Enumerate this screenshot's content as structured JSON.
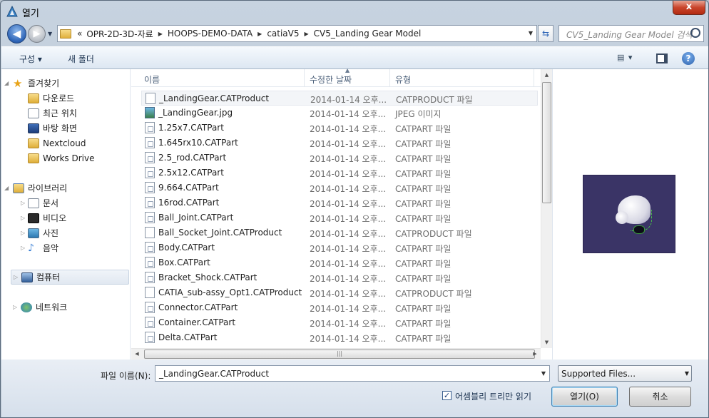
{
  "window": {
    "title": "열기",
    "close_label": "x"
  },
  "nav": {
    "back_label": "◀",
    "forward_label": "▶",
    "address_prefix": "«",
    "breadcrumbs": [
      "OPR-2D-3D-자료",
      "HOOPS-DEMO-DATA",
      "catiaV5",
      "CV5_Landing Gear Model"
    ],
    "search_placeholder": "CV5_Landing Gear Model 검색"
  },
  "toolbar": {
    "organize_label": "구성 ▾",
    "new_folder_label": "새 폴더",
    "view_label": "▤ ▾",
    "help_label": "?"
  },
  "sidebar": {
    "favorites": {
      "label": "즐겨찾기",
      "items": [
        "다운로드",
        "최근 위치",
        "바탕 화면",
        "Nextcloud",
        "Works Drive"
      ]
    },
    "libraries": {
      "label": "라이브러리",
      "items": [
        "문서",
        "비디오",
        "사진",
        "음악"
      ]
    },
    "computer_label": "컴퓨터",
    "network_label": "네트워크"
  },
  "filelist": {
    "columns": {
      "name": "이름",
      "date": "수정한 날짜",
      "type": "유형"
    },
    "rows": [
      {
        "name": "_LandingGear.CATProduct",
        "date": "2014-01-14 오후...",
        "type": "CATPRODUCT 파일",
        "icon": "blank"
      },
      {
        "name": "_LandingGear.jpg",
        "date": "2014-01-14 오후...",
        "type": "JPEG 이미지",
        "icon": "image"
      },
      {
        "name": "1.25x7.CATPart",
        "date": "2014-01-14 오후...",
        "type": "CATPART 파일",
        "icon": "part"
      },
      {
        "name": "1.645rx10.CATPart",
        "date": "2014-01-14 오후...",
        "type": "CATPART 파일",
        "icon": "part"
      },
      {
        "name": "2.5_rod.CATPart",
        "date": "2014-01-14 오후...",
        "type": "CATPART 파일",
        "icon": "part"
      },
      {
        "name": "2.5x12.CATPart",
        "date": "2014-01-14 오후...",
        "type": "CATPART 파일",
        "icon": "part"
      },
      {
        "name": "9.664.CATPart",
        "date": "2014-01-14 오후...",
        "type": "CATPART 파일",
        "icon": "part"
      },
      {
        "name": "16rod.CATPart",
        "date": "2014-01-14 오후...",
        "type": "CATPART 파일",
        "icon": "part"
      },
      {
        "name": "Ball_Joint.CATPart",
        "date": "2014-01-14 오후...",
        "type": "CATPART 파일",
        "icon": "part"
      },
      {
        "name": "Ball_Socket_Joint.CATProduct",
        "date": "2014-01-14 오후...",
        "type": "CATPRODUCT 파일",
        "icon": "blank"
      },
      {
        "name": "Body.CATPart",
        "date": "2014-01-14 오후...",
        "type": "CATPART 파일",
        "icon": "part"
      },
      {
        "name": "Box.CATPart",
        "date": "2014-01-14 오후...",
        "type": "CATPART 파일",
        "icon": "part"
      },
      {
        "name": "Bracket_Shock.CATPart",
        "date": "2014-01-14 오후...",
        "type": "CATPART 파일",
        "icon": "part"
      },
      {
        "name": "CATIA_sub-assy_Opt1.CATProduct",
        "date": "2014-01-14 오후...",
        "type": "CATPRODUCT 파일",
        "icon": "blank"
      },
      {
        "name": "Connector.CATPart",
        "date": "2014-01-14 오후...",
        "type": "CATPART 파일",
        "icon": "part"
      },
      {
        "name": "Container.CATPart",
        "date": "2014-01-14 오후...",
        "type": "CATPART 파일",
        "icon": "part"
      },
      {
        "name": "Delta.CATPart",
        "date": "2014-01-14 오후...",
        "type": "CATPART 파일",
        "icon": "part"
      }
    ]
  },
  "bottom": {
    "filename_label": "파일 이름(N):",
    "filename_value": "_LandingGear.CATProduct",
    "filetype_value": "Supported Files...",
    "assembly_check_label": "어셈블리 트리만 읽기",
    "assembly_checked": true,
    "open_label": "열기(O)",
    "cancel_label": "취소"
  },
  "colors": {
    "accent": "#2c63b6",
    "close": "#c9452c"
  }
}
